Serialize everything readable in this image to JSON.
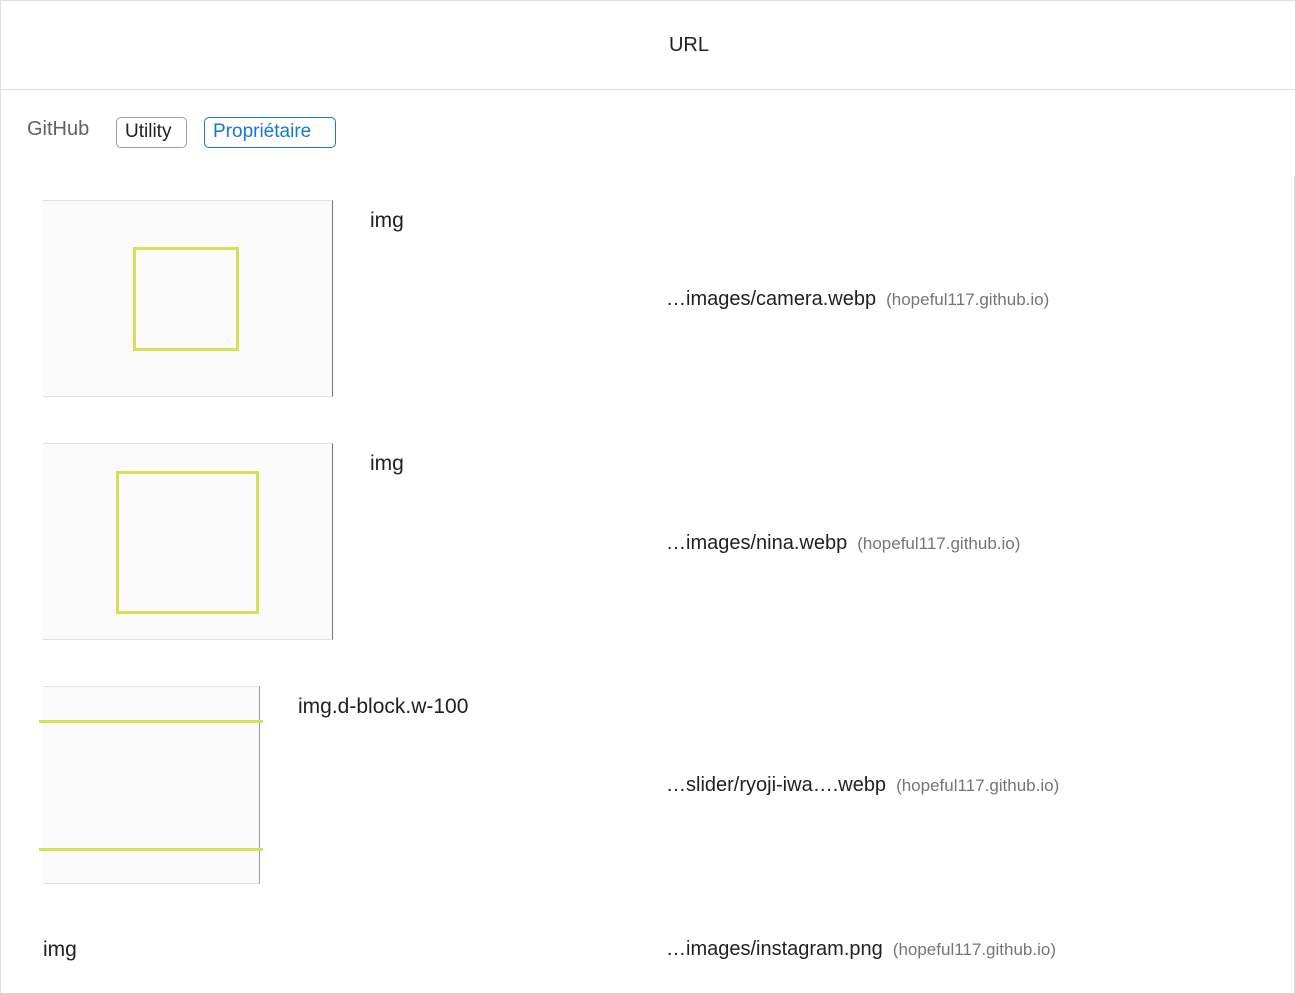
{
  "header": {
    "column_title": "URL"
  },
  "group": {
    "label": "GitHub",
    "tags": [
      "Utility",
      "Propriétaire"
    ]
  },
  "items": [
    {
      "node": "img",
      "url": "…images/camera.webp",
      "origin": "(hopeful117.github.io)"
    },
    {
      "node": "img",
      "url": "…images/nina.webp",
      "origin": "(hopeful117.github.io)"
    },
    {
      "node": "img.d-block.w-100",
      "url": "…slider/ryoji-iwa….webp",
      "origin": "(hopeful117.github.io)"
    },
    {
      "node": "img",
      "url": "…images/instagram.png",
      "origin": "(hopeful117.github.io)"
    }
  ],
  "colors": {
    "highlight": "#d4e157",
    "accent": "#1976d2"
  }
}
